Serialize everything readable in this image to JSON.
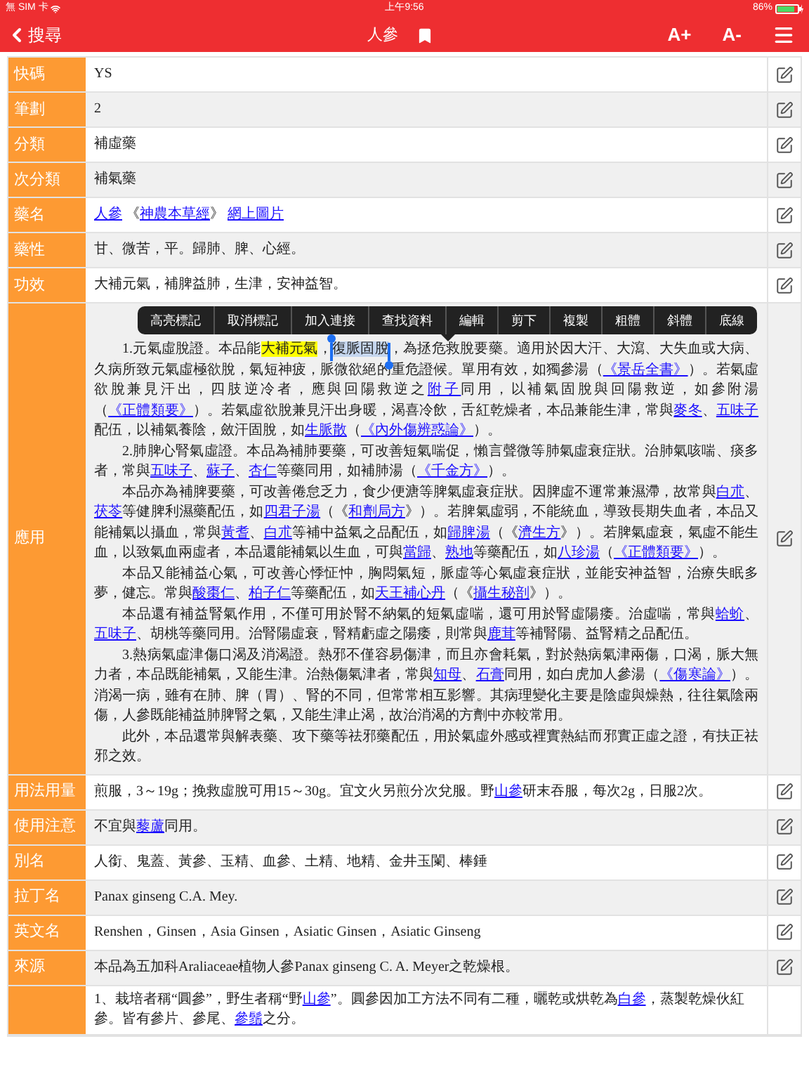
{
  "status_bar": {
    "carrier": "無 SIM 卡",
    "time": "上午9:56",
    "battery": "86%"
  },
  "nav": {
    "back": "搜尋",
    "title": "人參",
    "font_up": "A+",
    "font_down": "A-"
  },
  "context_menu": {
    "items": [
      "高亮標記",
      "取消標記",
      "加入連接",
      "查找資料",
      "編輯",
      "剪下",
      "複製",
      "粗體",
      "斜體",
      "底線"
    ]
  },
  "rows": [
    {
      "label": "快碼",
      "kind": "field",
      "editable": true,
      "paragraphs": [
        [
          {
            "kind": "text",
            "text": "YS"
          }
        ]
      ]
    },
    {
      "label": "筆劃",
      "kind": "field",
      "editable": true,
      "paragraphs": [
        [
          {
            "kind": "text",
            "text": "2"
          }
        ]
      ]
    },
    {
      "label": "分類",
      "kind": "field",
      "editable": true,
      "paragraphs": [
        [
          {
            "kind": "text",
            "text": "補虛藥"
          }
        ]
      ]
    },
    {
      "label": "次分類",
      "kind": "field",
      "editable": true,
      "paragraphs": [
        [
          {
            "kind": "text",
            "text": "補氣藥"
          }
        ]
      ]
    },
    {
      "label": "藥名",
      "kind": "field",
      "editable": true,
      "paragraphs": [
        [
          {
            "kind": "link",
            "text": "人參"
          },
          {
            "kind": "text",
            "text": " 《"
          },
          {
            "kind": "link",
            "text": "神農本草經"
          },
          {
            "kind": "text",
            "text": "》 "
          },
          {
            "kind": "link",
            "text": "網上圖片"
          }
        ]
      ]
    },
    {
      "label": "藥性",
      "kind": "field",
      "editable": true,
      "paragraphs": [
        [
          {
            "kind": "text",
            "text": "甘、微苦，平。歸肺、脾、心經。"
          }
        ]
      ]
    },
    {
      "label": "功效",
      "kind": "field",
      "editable": true,
      "paragraphs": [
        [
          {
            "kind": "text",
            "text": "大補元氣，補脾益肺，生津，安神益智。"
          }
        ]
      ]
    },
    {
      "label": "應用",
      "kind": "prose",
      "editable": true,
      "paragraphs": [
        [
          {
            "kind": "text",
            "text": "1.元氣虛脫證。本品能"
          },
          {
            "kind": "highlight",
            "text": "大補元氣"
          },
          {
            "kind": "text",
            "text": "，"
          },
          {
            "kind": "selected",
            "text": "復脈固脫"
          },
          {
            "kind": "text",
            "text": "，為拯危救脫要藥。適用於因大汗、大瀉、大失血或大病、久病所致元氣虛極欲脫，氣短神疲，脈微欲絕的重危證候。單用有效，如獨參湯（"
          },
          {
            "kind": "link",
            "text": "《景岳全書》"
          },
          {
            "kind": "text",
            "text": "）。若氣虛欲脫兼見汗出，四肢逆冷者，應與回陽救逆之"
          },
          {
            "kind": "link",
            "text": "附子"
          },
          {
            "kind": "text",
            "text": "同用，以補氣固脫與回陽救逆，如參附湯（"
          },
          {
            "kind": "link",
            "text": "《正體類要》"
          },
          {
            "kind": "text",
            "text": "）。若氣虛欲脫兼見汗出身暖，渴喜冷飲，舌紅乾燥者，本品兼能生津，常與"
          },
          {
            "kind": "link",
            "text": "麥冬"
          },
          {
            "kind": "text",
            "text": "、"
          },
          {
            "kind": "link",
            "text": "五味子"
          },
          {
            "kind": "text",
            "text": "配伍，以補氣養陰，斂汗固脫，如"
          },
          {
            "kind": "link",
            "text": "生脈散"
          },
          {
            "kind": "text",
            "text": "（"
          },
          {
            "kind": "link",
            "text": "《內外傷辨惑論》"
          },
          {
            "kind": "text",
            "text": "）。"
          }
        ],
        [
          {
            "kind": "text",
            "text": "2.肺脾心腎氣虛證。本品為補肺要藥，可改善短氣喘促，懶言聲微等肺氣虛衰症狀。治肺氣咳喘、痰多者，常與"
          },
          {
            "kind": "link",
            "text": "五味子"
          },
          {
            "kind": "text",
            "text": "、"
          },
          {
            "kind": "link",
            "text": "蘇子"
          },
          {
            "kind": "text",
            "text": "、"
          },
          {
            "kind": "link",
            "text": "杏仁"
          },
          {
            "kind": "text",
            "text": "等藥同用，如補肺湯（"
          },
          {
            "kind": "link",
            "text": "《千金方》"
          },
          {
            "kind": "text",
            "text": "）。"
          }
        ],
        [
          {
            "kind": "text",
            "text": "本品亦為補脾要藥，可改善倦怠乏力，食少便溏等脾氣虛衰症狀。因脾虛不運常兼濕滯，故常與"
          },
          {
            "kind": "link",
            "text": "白朮"
          },
          {
            "kind": "text",
            "text": "、"
          },
          {
            "kind": "link",
            "text": "茯苓"
          },
          {
            "kind": "text",
            "text": "等健脾利濕藥配伍，如"
          },
          {
            "kind": "link",
            "text": "四君子湯"
          },
          {
            "kind": "text",
            "text": "（《"
          },
          {
            "kind": "link",
            "text": "和劑局方"
          },
          {
            "kind": "text",
            "text": "》）。若脾氣虛弱，不能統血，導致長期失血者，本品又能補氣以攝血，常與"
          },
          {
            "kind": "link",
            "text": "黃耆"
          },
          {
            "kind": "text",
            "text": "、"
          },
          {
            "kind": "link",
            "text": "白朮"
          },
          {
            "kind": "text",
            "text": "等補中益氣之品配伍，如"
          },
          {
            "kind": "link",
            "text": "歸脾湯"
          },
          {
            "kind": "text",
            "text": "（《"
          },
          {
            "kind": "link",
            "text": "濟生方"
          },
          {
            "kind": "text",
            "text": "》）。若脾氣虛衰，氣虛不能生血，以致氣血兩虛者，本品還能補氣以生血，可與"
          },
          {
            "kind": "link",
            "text": "當歸"
          },
          {
            "kind": "text",
            "text": "、"
          },
          {
            "kind": "link",
            "text": "熟地"
          },
          {
            "kind": "text",
            "text": "等藥配伍，如"
          },
          {
            "kind": "link",
            "text": "八珍湯"
          },
          {
            "kind": "text",
            "text": "（"
          },
          {
            "kind": "link",
            "text": "《正體類要》"
          },
          {
            "kind": "text",
            "text": "）。"
          }
        ],
        [
          {
            "kind": "text",
            "text": "本品又能補益心氣，可改善心悸怔忡，胸悶氣短，脈虛等心氣虛衰症狀，並能安神益智，治療失眠多夢，健忘。常與"
          },
          {
            "kind": "link",
            "text": "酸棗仁"
          },
          {
            "kind": "text",
            "text": "、"
          },
          {
            "kind": "link",
            "text": "柏子仁"
          },
          {
            "kind": "text",
            "text": "等藥配伍，如"
          },
          {
            "kind": "link",
            "text": "天王補心丹"
          },
          {
            "kind": "text",
            "text": "（《"
          },
          {
            "kind": "link",
            "text": "攝生秘剖"
          },
          {
            "kind": "text",
            "text": "》）。"
          }
        ],
        [
          {
            "kind": "text",
            "text": "本品還有補益腎氣作用，不僅可用於腎不納氣的短氣虛喘，還可用於腎虛陽痿。治虛喘，常與"
          },
          {
            "kind": "link",
            "text": "蛤蚧"
          },
          {
            "kind": "text",
            "text": "、"
          },
          {
            "kind": "link",
            "text": "五味子"
          },
          {
            "kind": "text",
            "text": "、胡桃等藥同用。治腎陽虛衰，腎精虧虛之陽痿，則常與"
          },
          {
            "kind": "link",
            "text": "鹿茸"
          },
          {
            "kind": "text",
            "text": "等補腎陽、益腎精之品配伍。"
          }
        ],
        [
          {
            "kind": "text",
            "text": "3.熱病氣虛津傷口渴及消渴證。熱邪不僅容易傷津，而且亦會耗氣，對於熱病氣津兩傷，口渴，脈大無力者，本品既能補氣，又能生津。治熱傷氣津者，常與"
          },
          {
            "kind": "link",
            "text": "知母"
          },
          {
            "kind": "text",
            "text": "、"
          },
          {
            "kind": "link",
            "text": "石膏"
          },
          {
            "kind": "text",
            "text": "同用，如白虎加人參湯（"
          },
          {
            "kind": "link",
            "text": "《傷寒論》"
          },
          {
            "kind": "text",
            "text": "）。消渴一病，雖有在肺、脾（胃）、腎的不同，但常常相互影響。其病理變化主要是陰虛與燥熱，往往氣陰兩傷，人參既能補益肺脾腎之氣，又能生津止渴，故治消渴的方劑中亦較常用。"
          }
        ],
        [
          {
            "kind": "text",
            "text": "此外，本品還常與解表藥、攻下藥等祛邪藥配伍，用於氣虛外感或裡實熱結而邪實正虛之證，有扶正祛邪之效。"
          }
        ]
      ]
    },
    {
      "label": "用法用量",
      "kind": "field",
      "editable": true,
      "paragraphs": [
        [
          {
            "kind": "text",
            "text": "煎服，3～19g；挽救虛脫可用15～30g。宜文火另煎分次兌服。野"
          },
          {
            "kind": "link",
            "text": "山參"
          },
          {
            "kind": "text",
            "text": "研末吞服，每次2g，日服2次。"
          }
        ]
      ]
    },
    {
      "label": "使用注意",
      "kind": "field",
      "editable": true,
      "paragraphs": [
        [
          {
            "kind": "text",
            "text": "不宜與"
          },
          {
            "kind": "link",
            "text": "藜蘆"
          },
          {
            "kind": "text",
            "text": "同用。"
          }
        ]
      ]
    },
    {
      "label": "別名",
      "kind": "field",
      "editable": true,
      "paragraphs": [
        [
          {
            "kind": "text",
            "text": "人銜、鬼蓋、黃參、玉精、血參、土精、地精、金井玉闌、棒錘"
          }
        ]
      ]
    },
    {
      "label": "拉丁名",
      "kind": "field",
      "editable": true,
      "paragraphs": [
        [
          {
            "kind": "text",
            "text": "Panax ginseng C.A. Mey."
          }
        ]
      ]
    },
    {
      "label": "英文名",
      "kind": "field",
      "editable": true,
      "paragraphs": [
        [
          {
            "kind": "text",
            "text": "Renshen，Ginsen，Asia Ginsen，Asiatic Ginsen，Asiatic Ginseng"
          }
        ]
      ]
    },
    {
      "label": "來源",
      "kind": "field",
      "editable": true,
      "paragraphs": [
        [
          {
            "kind": "text",
            "text": "本品為五加科Araliaceae植物人參Panax ginseng C. A. Meyer之乾燥根。"
          }
        ]
      ]
    },
    {
      "kind": "field",
      "editable": false,
      "paragraphs": [
        [
          {
            "kind": "text",
            "text": "1、栽培者稱“圓參”，野生者稱“野"
          },
          {
            "kind": "link",
            "text": "山參"
          },
          {
            "kind": "text",
            "text": "”。圓參因加工方法不同有二種，曬乾或烘乾為"
          },
          {
            "kind": "link",
            "text": "白參"
          },
          {
            "kind": "text",
            "text": "，蒸製乾燥伙紅參。皆有參片、參尾、"
          },
          {
            "kind": "link",
            "text": "參鬚"
          },
          {
            "kind": "text",
            "text": "之分。"
          }
        ]
      ]
    }
  ]
}
